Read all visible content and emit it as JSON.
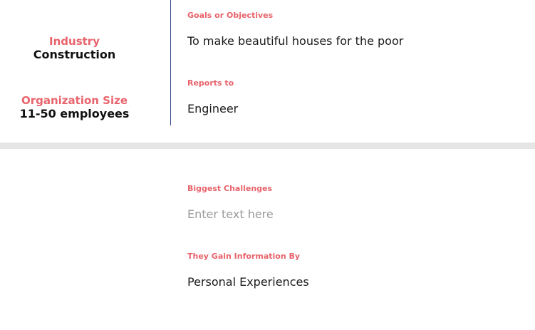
{
  "profile": {
    "industry": {
      "label": "Industry",
      "value": "Construction"
    },
    "organization_size": {
      "label": "Organization Size",
      "value": "11-50 employees"
    }
  },
  "fields": {
    "goals": {
      "label": "Goals or Objectives",
      "value": "To make beautiful houses for the poor"
    },
    "reports_to": {
      "label": "Reports to",
      "value": "Engineer"
    },
    "biggest_challenges": {
      "label": "Biggest Challenges",
      "value": "",
      "placeholder": "Enter text here"
    },
    "gain_information": {
      "label": "They Gain Information By",
      "value": "Personal Experiences"
    }
  },
  "colors": {
    "label_accent": "#e8636b",
    "divider": "#3b4a8c",
    "band": "#e5e5e5",
    "placeholder": "#9a9a9a"
  }
}
